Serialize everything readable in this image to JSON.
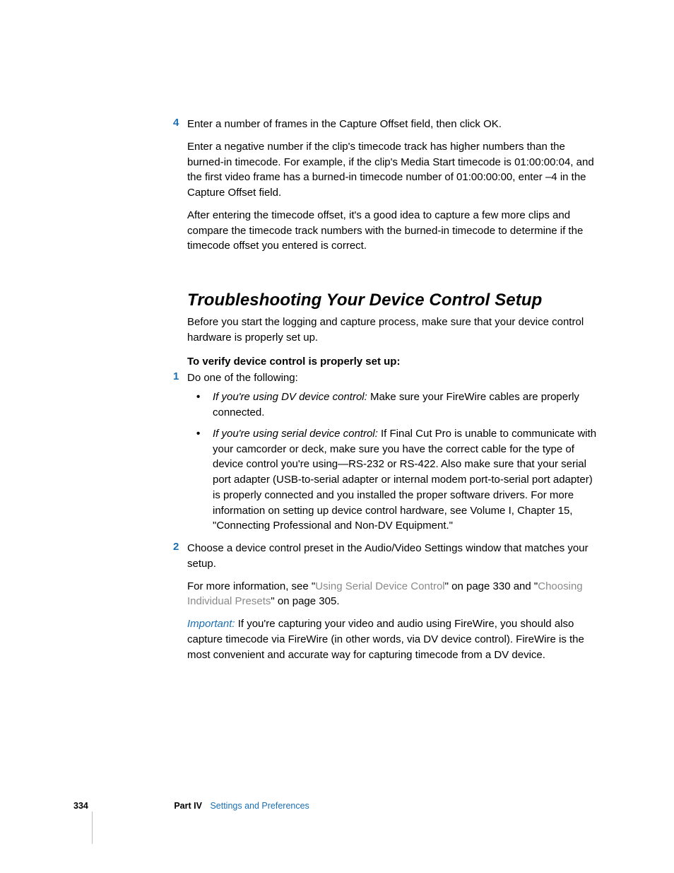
{
  "step4": {
    "num": "4",
    "lead": "Enter a number of frames in the Capture Offset field, then click OK.",
    "p1": "Enter a negative number if the clip's timecode track has higher numbers than the burned-in timecode. For example, if the clip's Media Start timecode is 01:00:00:04, and the first video frame has a burned-in timecode number of 01:00:00:00, enter –4 in the Capture Offset field.",
    "p2": "After entering the timecode offset, it's a good idea to capture a few more clips and compare the timecode track numbers with the burned-in timecode to determine if the timecode offset you entered is correct."
  },
  "section": {
    "heading": "Troubleshooting Your Device Control Setup",
    "intro": "Before you start the logging and capture process, make sure that your device control hardware is properly set up.",
    "lead": "To verify device control is properly set up:",
    "step1": {
      "num": "1",
      "text": "Do one of the following:",
      "bullet_a_lead": "If you're using DV device control:  ",
      "bullet_a_rest": "Make sure your FireWire cables are properly connected.",
      "bullet_b_lead": "If you're using serial device control:  ",
      "bullet_b_rest": "If Final Cut Pro is unable to communicate with your camcorder or deck, make sure you have the correct cable for the type of device control you're using—RS-232 or RS-422. Also make sure that your serial port adapter (USB-to-serial adapter or internal modem port-to-serial port adapter) is properly connected and you installed the proper software drivers. For more information on setting up device control hardware, see Volume I, Chapter 15, \"Connecting Professional and Non-DV Equipment.\""
    },
    "step2": {
      "num": "2",
      "text": "Choose a device control preset in the Audio/Video Settings window that matches your setup.",
      "more_a": "For more information, see \"",
      "link1": "Using Serial Device Control",
      "more_b": "\" on page 330 and \"",
      "link2": "Choosing Individual Presets",
      "more_c": "\" on page 305."
    },
    "important": {
      "label": "Important:  ",
      "text": "If you're capturing your video and audio using FireWire, you should also capture timecode via FireWire (in other words, via DV device control). FireWire is the most convenient and accurate way for capturing timecode from a DV device."
    }
  },
  "footer": {
    "page": "334",
    "part_label": "Part IV",
    "part_title": "Settings and Preferences"
  }
}
